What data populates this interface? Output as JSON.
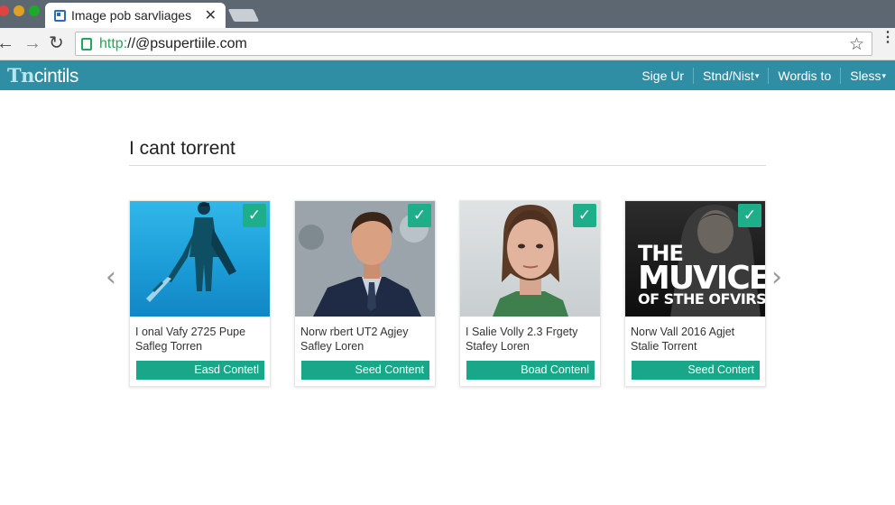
{
  "browser": {
    "tab_title": "Image pob sarvliages",
    "tab_close": "✕",
    "url_scheme": "http:",
    "url_rest": "//@psupertiile.com",
    "star": "☆",
    "menu": "⋮"
  },
  "header": {
    "logo_mark": "Tn",
    "logo_text": "cintils",
    "nav": [
      {
        "label": "Sige Ur",
        "caret": ""
      },
      {
        "label": "Stnd/Nist",
        "caret": "▾"
      },
      {
        "label": "Wordis to",
        "caret": ""
      },
      {
        "label": "Sless",
        "caret": "▾"
      }
    ]
  },
  "main": {
    "section_title": "I cant torrent",
    "prev_arrow": "‹",
    "next_arrow": "›",
    "cards": [
      {
        "caption_line1": "I onal Vafy 2725 Pupe",
        "caption_line2": "Safleg Torren",
        "button": "Easd Contetl",
        "check": "✓"
      },
      {
        "caption_line1": "Norw rbert UT2 Agjey",
        "caption_line2": "Safley Loren",
        "button": "Seed Content",
        "check": "✓"
      },
      {
        "caption_line1": "I Salie Volly 2.3 Frgety",
        "caption_line2": "Stafey Loren",
        "button": "Boad Contenl",
        "check": "✓"
      },
      {
        "caption_line1": "Norw Vall 2016 Agjet",
        "caption_line2": "Stalie Torrent",
        "button": "Seed Contert",
        "check": "✓"
      }
    ],
    "poster": {
      "line1": "THE",
      "line2": "MUVICE",
      "line3": "OF STHE OFVIRS"
    }
  },
  "colors": {
    "header_bg": "#2f8ea3",
    "accent_green": "#18a889",
    "check_green": "#1eae8a"
  }
}
